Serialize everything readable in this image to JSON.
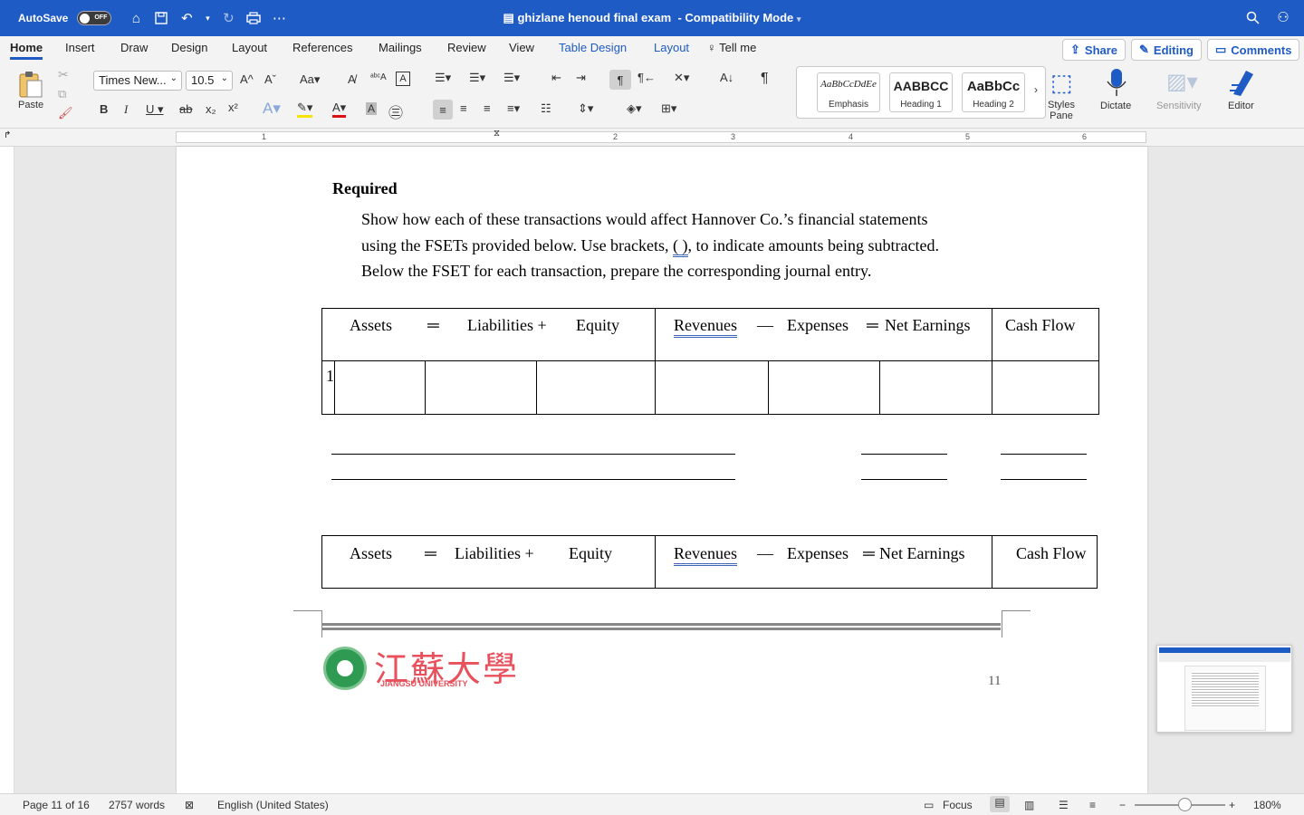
{
  "titlebar": {
    "autosave_label": "AutoSave",
    "autosave_state": "OFF",
    "doc_title": "ghizlane henoud final exam",
    "mode": "-  Compatibility Mode"
  },
  "tabs": {
    "home": "Home",
    "insert": "Insert",
    "draw": "Draw",
    "design": "Design",
    "layout": "Layout",
    "references": "References",
    "mailings": "Mailings",
    "review": "Review",
    "view": "View",
    "table_design": "Table Design",
    "table_layout": "Layout",
    "tell_me": "Tell me",
    "share": "Share",
    "editing": "Editing",
    "comments": "Comments"
  },
  "ribbon": {
    "paste": "Paste",
    "font_name": "Times New...",
    "font_size": "10.5",
    "styles": [
      {
        "sample": "AaBbCcDdEe",
        "name": "Emphasis"
      },
      {
        "sample": "AABBCC",
        "name": "Heading 1"
      },
      {
        "sample": "AaBbCc",
        "name": "Heading 2"
      }
    ],
    "styles_pane": "Styles\nPane",
    "styles_pane_1": "Styles",
    "styles_pane_2": "Pane",
    "dictate": "Dictate",
    "sensitivity": "Sensitivity",
    "editor": "Editor"
  },
  "ruler": {
    "numbers": [
      "1",
      "2",
      "3",
      "4",
      "5",
      "6"
    ]
  },
  "document": {
    "required": "Required",
    "para_line1": "Show how each of these transactions would affect Hannover Co.’s financial statements",
    "para_line2a": "using the FSETs provided below. Use brackets, ",
    "para_brackets": "( )",
    "para_line2b": ", to indicate amounts being subtracted.",
    "para_line3": "Below the FSET for each transaction, prepare the corresponding journal entry.",
    "fset_headers": {
      "assets": "Assets",
      "eq1": "═",
      "liabilities": "Liabilities +",
      "equity": "Equity",
      "revenues": "Revenues",
      "minus": "—",
      "expenses": "Expenses",
      "eq2": "═",
      "net_earnings": "Net Earnings",
      "cash_flow": "Cash Flow"
    },
    "row_number": "1",
    "page_number": "11",
    "logo_cn": "江蘇大學",
    "logo_en": "JIANGSU UNIVERSITY"
  },
  "status": {
    "page": "Page 11 of 16",
    "words": "2757 words",
    "language": "English (United States)",
    "focus": "Focus",
    "zoom": "180%"
  }
}
